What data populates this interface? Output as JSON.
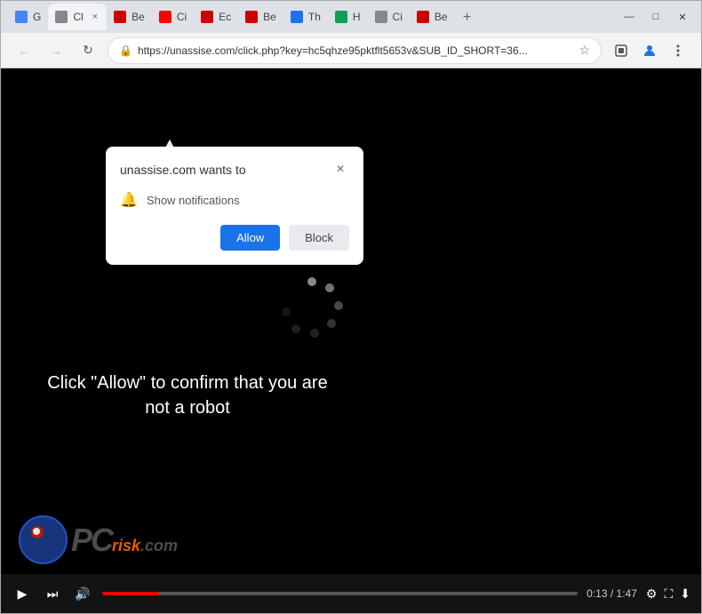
{
  "browser": {
    "tabs": [
      {
        "id": "tab1",
        "label": "G",
        "active": false,
        "favicon_color": "#4285f4",
        "close": "×"
      },
      {
        "id": "tab2",
        "label": "Cl",
        "active": true,
        "favicon_color": "#888",
        "close": "×"
      },
      {
        "id": "tab3",
        "label": "Be",
        "active": false,
        "favicon_color": "#cc0000",
        "close": "×"
      },
      {
        "id": "tab4",
        "label": "Ci",
        "active": false,
        "favicon_color": "#ff0000",
        "close": "×"
      },
      {
        "id": "tab5",
        "label": "Ec",
        "active": false,
        "favicon_color": "#cc0000",
        "close": "×"
      },
      {
        "id": "tab6",
        "label": "Be",
        "active": false,
        "favicon_color": "#cc0000",
        "close": "×"
      },
      {
        "id": "tab7",
        "label": "Th",
        "active": false,
        "favicon_color": "#1a73e8",
        "close": "×"
      },
      {
        "id": "tab8",
        "label": "H",
        "active": false,
        "favicon_color": "#0f9d58",
        "close": "×"
      },
      {
        "id": "tab9",
        "label": "Ci",
        "active": false,
        "favicon_color": "#888",
        "close": "×"
      },
      {
        "id": "tab10",
        "label": "Be",
        "active": false,
        "favicon_color": "#cc0000",
        "close": "×"
      }
    ],
    "new_tab_label": "+",
    "window_controls": {
      "minimize": "—",
      "maximize": "□",
      "close": "✕"
    },
    "address": "https://unassise.com/click.php?key=hc5qhze95pktflt5653v&SUB_ID_SHORT=36...",
    "star": "☆"
  },
  "popup": {
    "title": "unassise.com wants to",
    "close": "×",
    "permission_icon": "🔔",
    "permission_label": "Show notifications",
    "allow_label": "Allow",
    "block_label": "Block"
  },
  "page": {
    "caption": "Click \"Allow\" to confirm that you are not a robot"
  },
  "video_controls": {
    "play": "▶",
    "next": "⏭",
    "volume": "🔊",
    "time": "0:13 / 1:47",
    "settings": "⚙",
    "fullscreen": "⛶",
    "download": "⬇"
  },
  "logo": {
    "pc_text": "PC",
    "risk_text": "risk",
    "com_text": ".com"
  }
}
